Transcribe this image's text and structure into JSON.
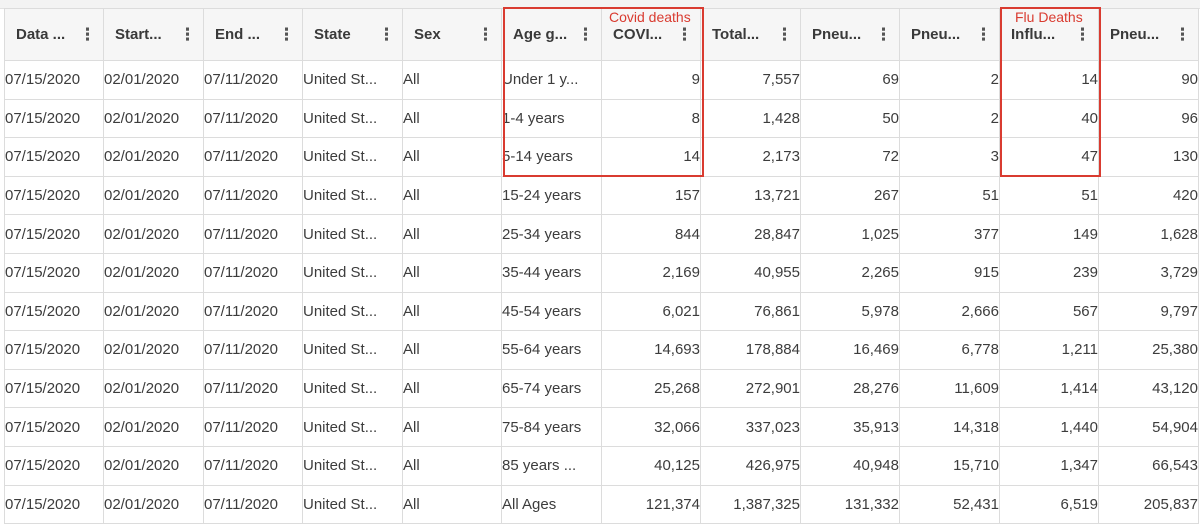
{
  "annotations": {
    "covid": "Covid deaths",
    "flu": "Flu Deaths",
    "accent_color": "#d93b30"
  },
  "columns": [
    {
      "label": "Data ...",
      "align": "txt",
      "width": 99
    },
    {
      "label": "Start...",
      "align": "txt",
      "width": 100
    },
    {
      "label": "End ...",
      "align": "txt",
      "width": 99
    },
    {
      "label": "State",
      "align": "txt",
      "width": 100
    },
    {
      "label": "Sex",
      "align": "txt",
      "width": 99
    },
    {
      "label": "Age g...",
      "align": "txt",
      "width": 100
    },
    {
      "label": "COVI...",
      "align": "num",
      "width": 99
    },
    {
      "label": "Total...",
      "align": "num",
      "width": 100
    },
    {
      "label": "Pneu...",
      "align": "num",
      "width": 99
    },
    {
      "label": "Pneu...",
      "align": "num",
      "width": 100
    },
    {
      "label": "Influ...",
      "align": "num",
      "width": 99
    },
    {
      "label": "Pneu...",
      "align": "num",
      "width": 100
    }
  ],
  "menu_icon": "more-vertical-icon",
  "rows": [
    [
      "07/15/2020",
      "02/01/2020",
      "07/11/2020",
      "United St...",
      "All",
      "Under 1 y...",
      "9",
      "7,557",
      "69",
      "2",
      "14",
      "90"
    ],
    [
      "07/15/2020",
      "02/01/2020",
      "07/11/2020",
      "United St...",
      "All",
      "1-4 years",
      "8",
      "1,428",
      "50",
      "2",
      "40",
      "96"
    ],
    [
      "07/15/2020",
      "02/01/2020",
      "07/11/2020",
      "United St...",
      "All",
      "5-14 years",
      "14",
      "2,173",
      "72",
      "3",
      "47",
      "130"
    ],
    [
      "07/15/2020",
      "02/01/2020",
      "07/11/2020",
      "United St...",
      "All",
      "15-24 years",
      "157",
      "13,721",
      "267",
      "51",
      "51",
      "420"
    ],
    [
      "07/15/2020",
      "02/01/2020",
      "07/11/2020",
      "United St...",
      "All",
      "25-34 years",
      "844",
      "28,847",
      "1,025",
      "377",
      "149",
      "1,628"
    ],
    [
      "07/15/2020",
      "02/01/2020",
      "07/11/2020",
      "United St...",
      "All",
      "35-44 years",
      "2,169",
      "40,955",
      "2,265",
      "915",
      "239",
      "3,729"
    ],
    [
      "07/15/2020",
      "02/01/2020",
      "07/11/2020",
      "United St...",
      "All",
      "45-54 years",
      "6,021",
      "76,861",
      "5,978",
      "2,666",
      "567",
      "9,797"
    ],
    [
      "07/15/2020",
      "02/01/2020",
      "07/11/2020",
      "United St...",
      "All",
      "55-64 years",
      "14,693",
      "178,884",
      "16,469",
      "6,778",
      "1,211",
      "25,380"
    ],
    [
      "07/15/2020",
      "02/01/2020",
      "07/11/2020",
      "United St...",
      "All",
      "65-74 years",
      "25,268",
      "272,901",
      "28,276",
      "11,609",
      "1,414",
      "43,120"
    ],
    [
      "07/15/2020",
      "02/01/2020",
      "07/11/2020",
      "United St...",
      "All",
      "75-84 years",
      "32,066",
      "337,023",
      "35,913",
      "14,318",
      "1,440",
      "54,904"
    ],
    [
      "07/15/2020",
      "02/01/2020",
      "07/11/2020",
      "United St...",
      "All",
      "85 years ...",
      "40,125",
      "426,975",
      "40,948",
      "15,710",
      "1,347",
      "66,543"
    ],
    [
      "07/15/2020",
      "02/01/2020",
      "07/11/2020",
      "United St...",
      "All",
      "All Ages",
      "121,374",
      "1,387,325",
      "131,332",
      "52,431",
      "6,519",
      "205,837"
    ]
  ]
}
